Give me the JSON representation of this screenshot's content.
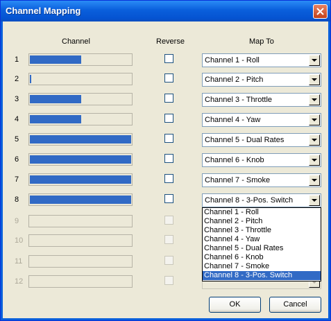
{
  "window": {
    "title": "Channel Mapping"
  },
  "headers": {
    "channel": "Channel",
    "reverse": "Reverse",
    "map_to": "Map To"
  },
  "rows": [
    {
      "num": "1",
      "level": 0.51,
      "enabled": true,
      "map": "Channel 1 - Roll"
    },
    {
      "num": "2",
      "level": 0.0,
      "enabled": true,
      "map": "Channel 2 - Pitch"
    },
    {
      "num": "3",
      "level": 0.51,
      "enabled": true,
      "map": "Channel 3 - Throttle"
    },
    {
      "num": "4",
      "level": 0.51,
      "enabled": true,
      "map": "Channel 4 - Yaw"
    },
    {
      "num": "5",
      "level": 1.0,
      "enabled": true,
      "map": "Channel 5 - Dual Rates"
    },
    {
      "num": "6",
      "level": 1.0,
      "enabled": true,
      "map": "Channel 6 - Knob"
    },
    {
      "num": "7",
      "level": 1.0,
      "enabled": true,
      "map": "Channel 7 - Smoke"
    },
    {
      "num": "8",
      "level": 1.0,
      "enabled": true,
      "map": "Channel 8 - 3-Pos. Switch"
    },
    {
      "num": "9",
      "level": 0,
      "enabled": false,
      "map": ""
    },
    {
      "num": "10",
      "level": 0,
      "enabled": false,
      "map": ""
    },
    {
      "num": "11",
      "level": 0,
      "enabled": false,
      "map": ""
    },
    {
      "num": "12",
      "level": 0,
      "enabled": false,
      "map": ""
    }
  ],
  "dropdown_options": [
    "Channel 1 - Roll",
    "Channel 2 - Pitch",
    "Channel 3 - Throttle",
    "Channel 4 - Yaw",
    "Channel 5 - Dual Rates",
    "Channel 6 - Knob",
    "Channel 7 - Smoke",
    "Channel 8 - 3-Pos. Switch"
  ],
  "dropdown_selected": "Channel 8 - 3-Pos. Switch",
  "buttons": {
    "ok": "OK",
    "cancel": "Cancel"
  },
  "icons": {
    "close": "close-icon",
    "combo_arrow": "chevron-down-icon"
  },
  "colors": {
    "titlebar": "#0a5fdc",
    "bar_fill": "#316ac5",
    "dialog_bg": "#ece9d8"
  }
}
